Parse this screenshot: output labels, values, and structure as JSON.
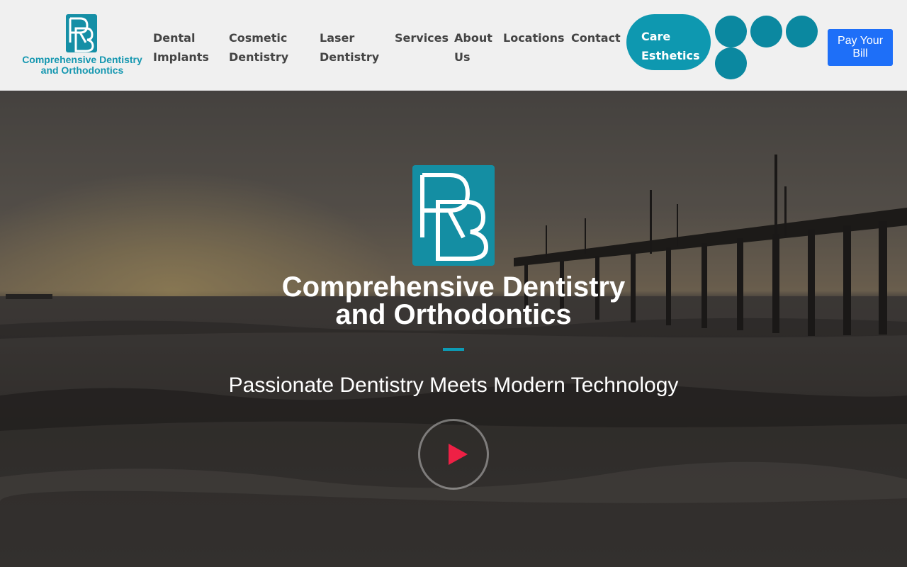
{
  "brand": {
    "line1": "Comprehensive Dentistry",
    "line2": "and Orthodontics",
    "monogram": "RB",
    "color": "#1597b0"
  },
  "nav": {
    "items": [
      {
        "line1": "Dental",
        "line2": "Implants"
      },
      {
        "line1": "Cosmetic",
        "line2": "Dentistry"
      },
      {
        "line1": "Laser",
        "line2": "Dentistry"
      },
      {
        "line1": "Services",
        "line2": ""
      },
      {
        "line1": "About",
        "line2": "Us"
      },
      {
        "line1": "Locations",
        "line2": ""
      },
      {
        "line1": "Contact",
        "line2": ""
      }
    ],
    "care_button": {
      "line1": "Care",
      "line2": "Esthetics",
      "color": "#0e98b0"
    },
    "social_icons": [
      {
        "icon": "facebook-icon",
        "glyph": ""
      },
      {
        "icon": "instagram-icon",
        "glyph": ""
      },
      {
        "icon": "youtube-icon",
        "glyph": ""
      },
      {
        "icon": "map-marker-icon",
        "glyph": ""
      }
    ],
    "pay_button": {
      "line1": "Pay Your",
      "line2": "Bill",
      "color": "#1e6ff8"
    }
  },
  "hero": {
    "title_line1": "Comprehensive Dentistry",
    "title_line2": "and Orthodontics",
    "tagline": "Passionate Dentistry Meets Modern Technology",
    "play_icon": "play-icon",
    "accent": "#ee2045",
    "background": "beach sunset with fishing pier"
  }
}
